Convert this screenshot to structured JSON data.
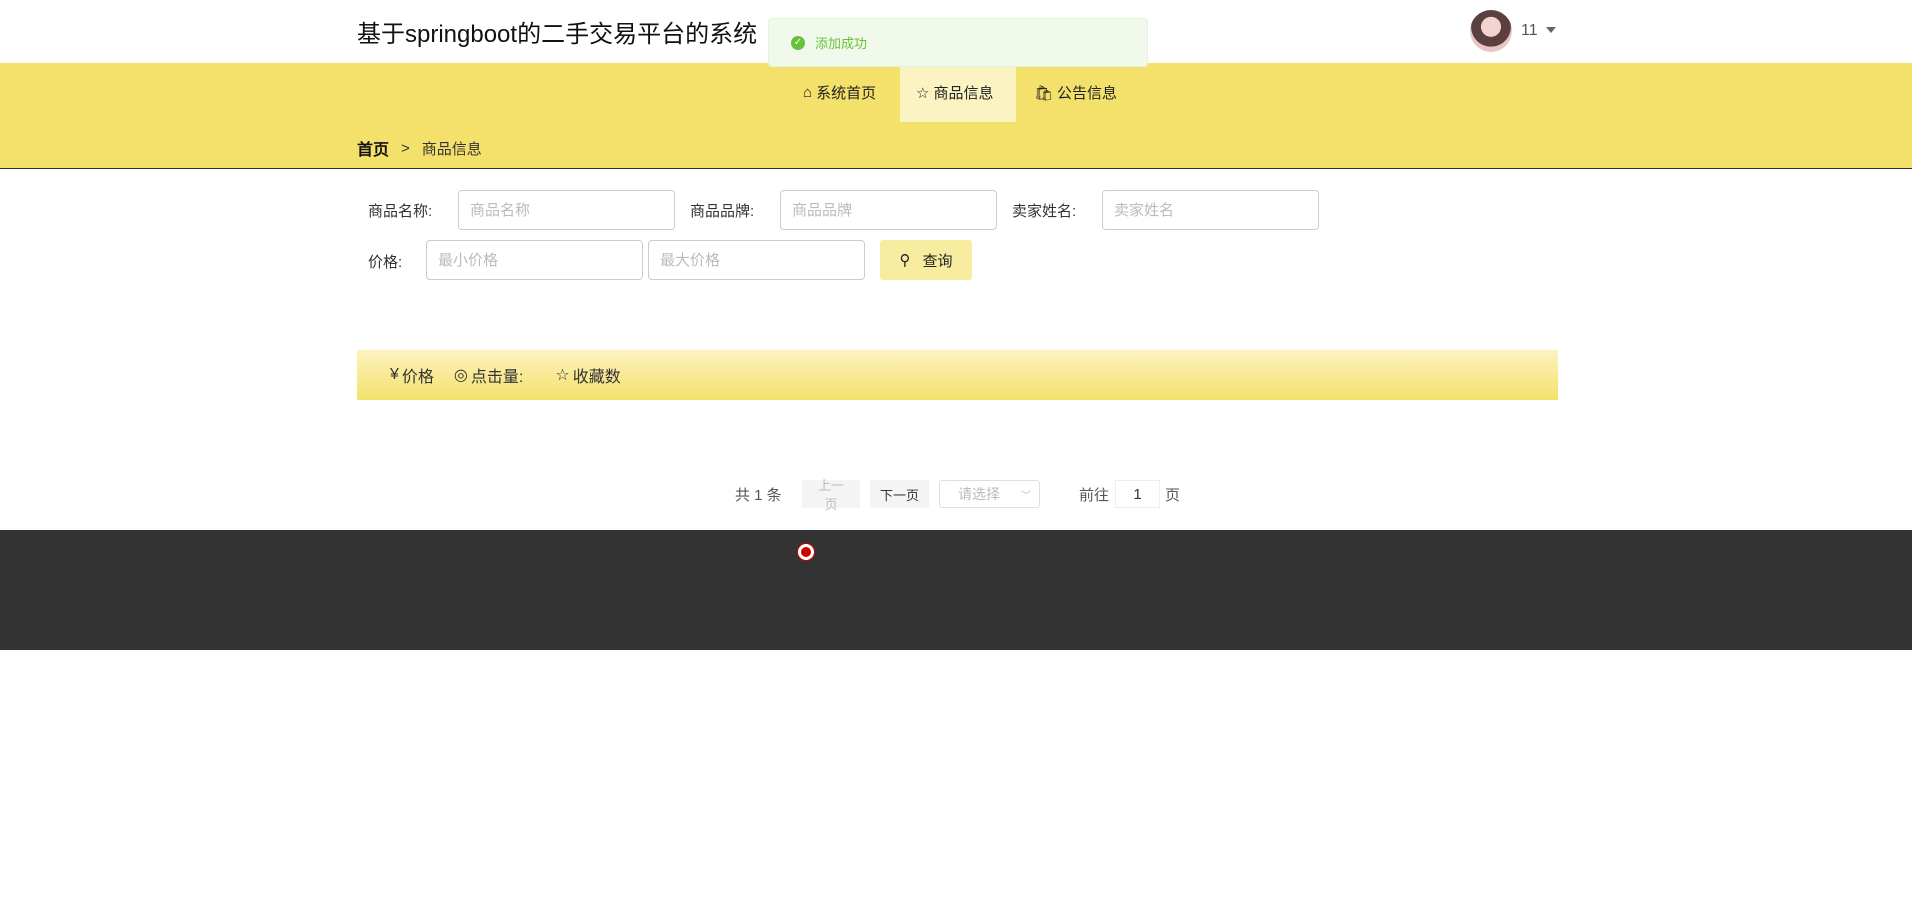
{
  "header": {
    "title": "基于springboot的二手交易平台的系统",
    "username": "11"
  },
  "toast": {
    "message": "添加成功",
    "type": "success"
  },
  "nav": {
    "items": [
      {
        "label": "系统首页",
        "icon": "home-icon"
      },
      {
        "label": "商品信息",
        "icon": "star-icon",
        "active": true
      },
      {
        "label": "公告信息",
        "icon": "bag-icon"
      }
    ]
  },
  "breadcrumb": {
    "home": "首页",
    "separator": ">",
    "current": "商品信息"
  },
  "search": {
    "name_label": "商品名称:",
    "name_placeholder": "商品名称",
    "name_value": "",
    "brand_label": "商品品牌:",
    "brand_placeholder": "商品品牌",
    "brand_value": "",
    "seller_label": "卖家姓名:",
    "seller_placeholder": "卖家姓名",
    "seller_value": "",
    "price_label": "价格:",
    "min_placeholder": "最小价格",
    "max_placeholder": "最大价格",
    "query_label": "查询"
  },
  "product": {
    "price_symbol": "¥",
    "price_label": "价格",
    "clicks_label": "点击量:",
    "favorites_label": "收藏数"
  },
  "pagination": {
    "total": "共 1 条",
    "prev": "上一页",
    "next": "下一页",
    "size_placeholder": "请选择",
    "goto": "前往",
    "page": "1",
    "page_suffix": "页"
  },
  "colors": {
    "accent": "#f4e16b",
    "active_nav": "#fbf3c2",
    "footer": "#333333",
    "success": "#67c23a"
  }
}
